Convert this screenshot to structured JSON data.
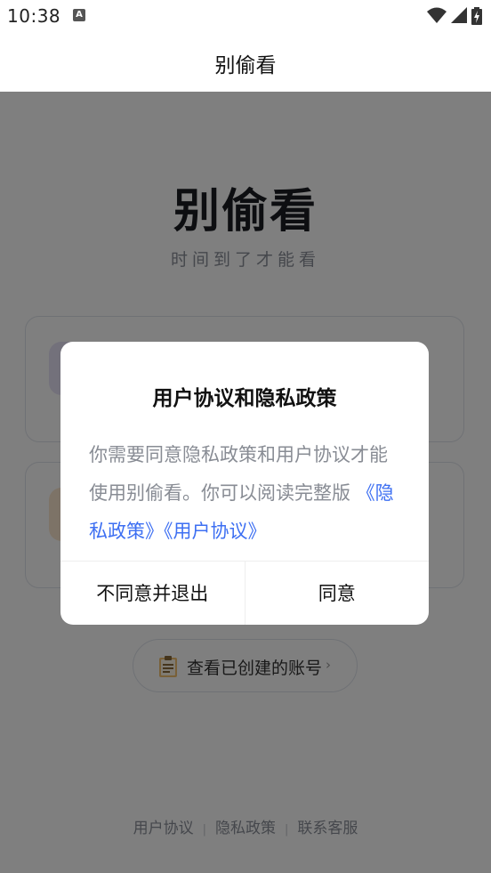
{
  "status_bar": {
    "time": "10:38",
    "notification_icon_letter": "A",
    "icons": [
      "wifi-icon",
      "signal-icon",
      "battery-charging-icon"
    ]
  },
  "nav": {
    "title": "别偷看"
  },
  "app": {
    "title": "别偷看",
    "subtitle": "时间到了才能看"
  },
  "accounts_button": {
    "label": "查看已创建的账号",
    "chevron": "›",
    "icon": "clipboard-icon"
  },
  "footer": {
    "links": [
      "用户协议",
      "隐私政策",
      "联系客服"
    ],
    "separator": "|"
  },
  "dialog": {
    "title": "用户协议和隐私政策",
    "body_text": "你需要同意隐私政策和用户协议才能使用别偷看。你可以阅读完整版",
    "privacy_link": "《隐私政策》",
    "terms_link": "《用户协议》",
    "disagree_label": "不同意并退出",
    "agree_label": "同意"
  },
  "colors": {
    "accent": "#3d6ff2",
    "overlay": "rgba(0,0,0,0.5)",
    "card_icon_1": "#e6e2f7",
    "card_icon_2": "#fbe6cf"
  }
}
